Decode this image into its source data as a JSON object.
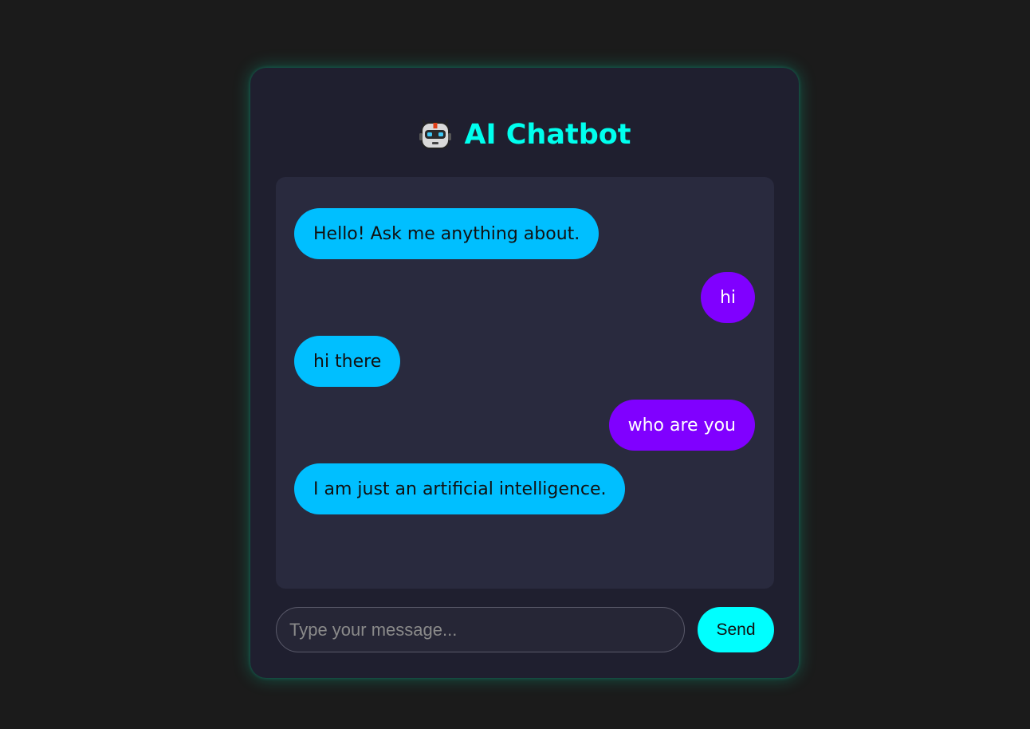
{
  "app": {
    "title": "AI Chatbot",
    "icon": "robot-icon"
  },
  "messages": [
    {
      "sender": "bot",
      "text": "Hello! Ask me anything about."
    },
    {
      "sender": "user",
      "text": "hi"
    },
    {
      "sender": "bot",
      "text": "hi there"
    },
    {
      "sender": "user",
      "text": "who are you"
    },
    {
      "sender": "bot",
      "text": "I am just an artificial intelligence."
    }
  ],
  "composer": {
    "placeholder": "Type your message...",
    "value": "",
    "send_label": "Send"
  },
  "colors": {
    "background": "#1b1b1b",
    "card": "#1f1f2f",
    "messages_panel": "#292a3e",
    "title_accent": "#00ffee",
    "bot_bubble": "#00bfff",
    "user_bubble": "#8000ff",
    "send_button": "#00ffff"
  }
}
